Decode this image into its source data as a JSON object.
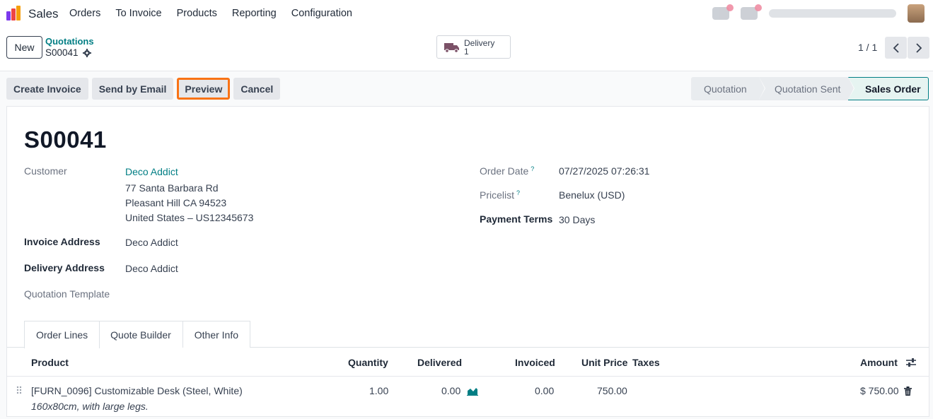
{
  "navbar": {
    "app_name": "Sales",
    "menu": [
      "Orders",
      "To Invoice",
      "Products",
      "Reporting",
      "Configuration"
    ],
    "brand_colors": [
      "#f59e0b",
      "#ef4444",
      "#7c3aed"
    ]
  },
  "control_panel": {
    "new_label": "New",
    "breadcrumb_parent": "Quotations",
    "breadcrumb_current": "S00041",
    "smart_button": {
      "label": "Delivery",
      "count": "1",
      "icon": "truck-icon"
    },
    "pager": "1 / 1"
  },
  "actions": {
    "create_invoice": "Create Invoice",
    "send_by_email": "Send by Email",
    "preview": "Preview",
    "cancel": "Cancel"
  },
  "statusbar": {
    "stages": [
      "Quotation",
      "Quotation Sent",
      "Sales Order"
    ],
    "current": "Sales Order"
  },
  "form": {
    "name": "S00041",
    "customer_label": "Customer",
    "customer_name": "Deco Addict",
    "customer_address": [
      "77 Santa Barbara Rd",
      "Pleasant Hill CA 94523",
      "United States – US12345673"
    ],
    "invoice_address_label": "Invoice Address",
    "invoice_address": "Deco Addict",
    "delivery_address_label": "Delivery Address",
    "delivery_address": "Deco Addict",
    "quotation_template_label": "Quotation Template",
    "order_date_label": "Order Date",
    "order_date": "07/27/2025 07:26:31",
    "pricelist_label": "Pricelist",
    "pricelist": "Benelux (USD)",
    "payment_terms_label": "Payment Terms",
    "payment_terms": "30 Days",
    "help_mark": "?"
  },
  "tabs": [
    "Order Lines",
    "Quote Builder",
    "Other Info"
  ],
  "order_lines": {
    "columns": [
      "Product",
      "Quantity",
      "Delivered",
      "Invoiced",
      "Unit Price",
      "Taxes",
      "Amount"
    ],
    "rows": [
      {
        "product": "[FURN_0096] Customizable Desk (Steel, White)",
        "description": "160x80cm, with large legs.",
        "quantity": "1.00",
        "delivered": "0.00",
        "invoiced": "0.00",
        "unit_price": "750.00",
        "taxes": "",
        "amount": "$ 750.00"
      }
    ]
  },
  "colors": {
    "accent": "#017e84",
    "highlight": "#f97316"
  }
}
